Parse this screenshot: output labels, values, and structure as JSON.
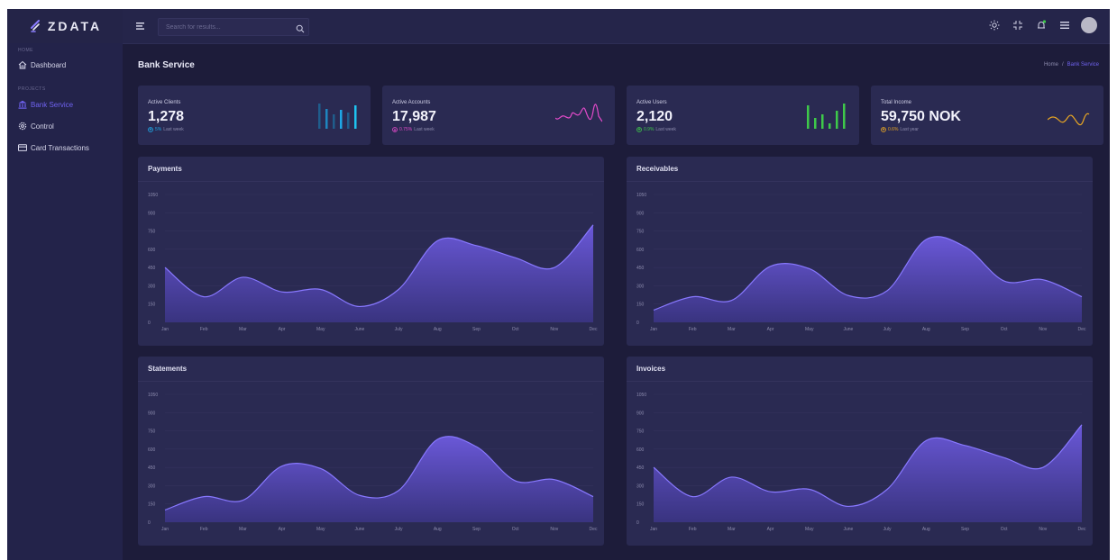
{
  "brand": {
    "name": "ZDATA"
  },
  "topbar": {
    "search_placeholder": "Search for results...",
    "icons": [
      "sun-icon",
      "fullscreen-icon",
      "bell-icon",
      "list-icon"
    ]
  },
  "sidebar": {
    "sections": [
      {
        "label": "HOME",
        "items": [
          {
            "label": "Dashboard",
            "icon": "home-icon",
            "active": false
          }
        ]
      },
      {
        "label": "PROJECTS",
        "items": [
          {
            "label": "Bank Service",
            "icon": "bank-icon",
            "active": true
          },
          {
            "label": "Control",
            "icon": "gear-icon",
            "active": false
          },
          {
            "label": "Card Transactions",
            "icon": "card-icon",
            "active": false
          }
        ]
      }
    ]
  },
  "page": {
    "title": "Bank Service",
    "breadcrumb": [
      "Home",
      "Bank Service"
    ]
  },
  "stats": [
    {
      "label": "Active Clients",
      "value": "1,278",
      "change": "5%",
      "period": "Last week",
      "color": "#1ea7e6",
      "spark": "bars"
    },
    {
      "label": "Active Accounts",
      "value": "17,987",
      "change": "0.75%",
      "period": "Last week",
      "color": "#e24ac9",
      "spark": "line"
    },
    {
      "label": "Active Users",
      "value": "2,120",
      "change": "0.9%",
      "period": "Last week",
      "color": "#3ec94a",
      "spark": "bars"
    },
    {
      "label": "Total Income",
      "value": "59,750 NOK",
      "change": "0.6%",
      "period": "Last year",
      "color": "#e8a623",
      "spark": "line"
    }
  ],
  "theme": {
    "accent": "#6f62f0",
    "area_top": "#6a58d8",
    "area_bottom": "#3a3482",
    "area_line": "#8878ff"
  },
  "chart_data": [
    {
      "type": "area",
      "title": "Payments",
      "categories": [
        "Jan",
        "Feb",
        "Mar",
        "Apr",
        "May",
        "June",
        "July",
        "Aug",
        "Sep",
        "Oct",
        "Nov",
        "Dec"
      ],
      "values": [
        450,
        210,
        370,
        250,
        270,
        130,
        270,
        670,
        630,
        530,
        450,
        800
      ],
      "yticks": [
        0,
        150,
        300,
        450,
        600,
        750,
        900,
        1050
      ],
      "ylim": [
        0,
        1050
      ],
      "grid": true
    },
    {
      "type": "area",
      "title": "Receivables",
      "categories": [
        "Jan",
        "Feb",
        "Mar",
        "Apr",
        "May",
        "June",
        "July",
        "Aug",
        "Sep",
        "Oct",
        "Nov",
        "Dec"
      ],
      "values": [
        100,
        210,
        180,
        460,
        440,
        220,
        260,
        680,
        620,
        340,
        350,
        210
      ],
      "yticks": [
        0,
        150,
        300,
        450,
        600,
        750,
        900,
        1050
      ],
      "ylim": [
        0,
        1050
      ],
      "grid": true
    },
    {
      "type": "area",
      "title": "Statements",
      "categories": [
        "Jan",
        "Feb",
        "Mar",
        "Apr",
        "May",
        "June",
        "July",
        "Aug",
        "Sep",
        "Oct",
        "Nov",
        "Dec"
      ],
      "values": [
        100,
        210,
        180,
        460,
        440,
        220,
        260,
        680,
        620,
        340,
        350,
        210
      ],
      "yticks": [
        0,
        150,
        300,
        450,
        600,
        750,
        900,
        1050
      ],
      "ylim": [
        0,
        1050
      ],
      "grid": true
    },
    {
      "type": "area",
      "title": "Invoices",
      "categories": [
        "Jan",
        "Feb",
        "Mar",
        "Apr",
        "May",
        "June",
        "July",
        "Aug",
        "Sep",
        "Oct",
        "Nov",
        "Dec"
      ],
      "values": [
        450,
        210,
        370,
        250,
        270,
        130,
        270,
        670,
        630,
        530,
        450,
        800
      ],
      "yticks": [
        0,
        150,
        300,
        450,
        600,
        750,
        900,
        1050
      ],
      "ylim": [
        0,
        1050
      ],
      "grid": true
    }
  ]
}
